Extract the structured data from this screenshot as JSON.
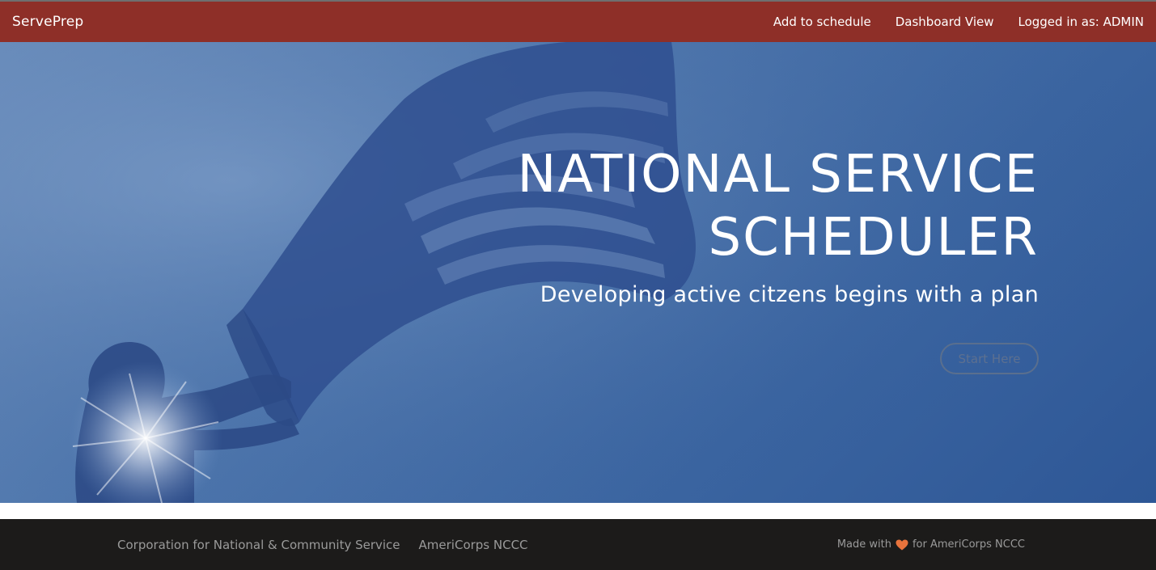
{
  "navbar": {
    "brand": "ServePrep",
    "links": [
      "Add to schedule",
      "Dashboard View",
      "Logged in as: ADMIN"
    ],
    "color": "#8e2f28"
  },
  "hero": {
    "title_line1": "NATIONAL SERVICE",
    "title_line2": "SCHEDULER",
    "subtitle": "Developing active citzens begins with a plan",
    "button_label": "Start Here",
    "overlay_color": "#3a64a0"
  },
  "footer": {
    "links": [
      "Corporation for National & Community Service",
      "AmeriCorps NCCC"
    ],
    "made_with_prefix": "Made with",
    "made_with_suffix": "for AmeriCorps NCCC",
    "heart_icon": "heart-icon",
    "heart_color": "#e8733c",
    "background": "#1c1b1a"
  }
}
